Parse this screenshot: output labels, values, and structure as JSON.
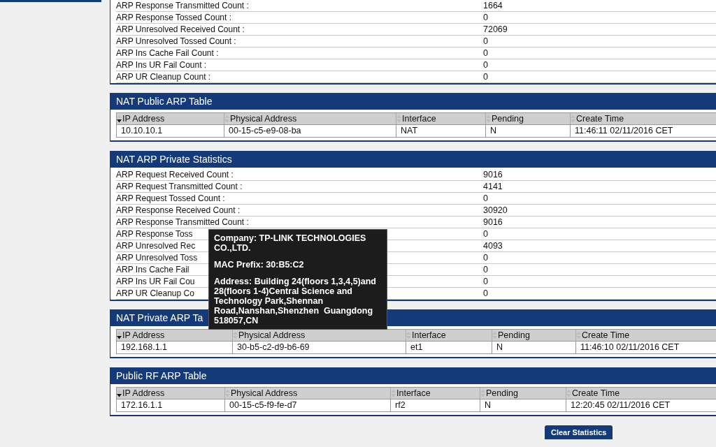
{
  "stats_top": {
    "rows": [
      {
        "label": "ARP Response Transmitted Count :",
        "value": "1664"
      },
      {
        "label": "ARP Response Tossed Count :",
        "value": "0"
      },
      {
        "label": "ARP Unresolved Received Count :",
        "value": "72069"
      },
      {
        "label": "ARP Unresolved Tossed Count :",
        "value": "0"
      },
      {
        "label": "ARP Ins Cache Fail Count :",
        "value": "0"
      },
      {
        "label": "ARP Ins UR Fail Count :",
        "value": "0"
      },
      {
        "label": "ARP UR Cleanup Count :",
        "value": "0"
      }
    ]
  },
  "nat_public_arp_table": {
    "title": "NAT Public ARP Table",
    "columns": [
      {
        "label": "IP Address",
        "sorted": true
      },
      {
        "label": "Physical Address",
        "sorted": false
      },
      {
        "label": "Interface",
        "sorted": false
      },
      {
        "label": "Pending",
        "sorted": false
      },
      {
        "label": "Create Time",
        "sorted": false
      }
    ],
    "rows": [
      [
        "10.10.10.1",
        "00-15-c5-e9-08-ba",
        "NAT",
        "N",
        "11:46:11 02/11/2016 CET"
      ]
    ]
  },
  "nat_arp_private_statistics": {
    "title": "NAT ARP Private Statistics",
    "rows": [
      {
        "label": "ARP Request Received Count :",
        "value": "9016"
      },
      {
        "label": "ARP Request Transmitted Count :",
        "value": "4141"
      },
      {
        "label": "ARP Request Tossed Count :",
        "value": "0"
      },
      {
        "label": "ARP Response Received Count :",
        "value": "30920"
      },
      {
        "label": "ARP Response Transmitted Count :",
        "value": "9016"
      },
      {
        "label": "ARP Response Toss",
        "value": "0"
      },
      {
        "label": "ARP Unresolved Rec",
        "value": "4093"
      },
      {
        "label": "ARP Unresolved Toss",
        "value": "0"
      },
      {
        "label": "ARP Ins Cache Fail",
        "value": "0"
      },
      {
        "label": "ARP Ins UR Fail Cou",
        "value": "0"
      },
      {
        "label": "ARP UR Cleanup Co",
        "value": "0"
      }
    ]
  },
  "nat_private_arp_table": {
    "title": "NAT Private ARP Ta",
    "columns": [
      {
        "label": "IP Address",
        "sorted": true
      },
      {
        "label": "Physical Address",
        "sorted": false
      },
      {
        "label": "Interface",
        "sorted": false
      },
      {
        "label": "Pending",
        "sorted": false
      },
      {
        "label": "Create Time",
        "sorted": false
      }
    ],
    "rows": [
      [
        "192.168.1.1",
        "30-b5-c2-d9-b6-69",
        "et1",
        "N",
        "11:46:10 02/11/2016 CET"
      ]
    ]
  },
  "public_rf_arp_table": {
    "title": "Public RF ARP Table",
    "columns": [
      {
        "label": "IP Address",
        "sorted": true
      },
      {
        "label": "Physical Address",
        "sorted": false
      },
      {
        "label": "Interface",
        "sorted": false
      },
      {
        "label": "Pending",
        "sorted": false
      },
      {
        "label": "Create Time",
        "sorted": false
      }
    ],
    "rows": [
      [
        "172.16.1.1",
        "00-15-c5-f9-fe-d7",
        "rf2",
        "N",
        "12:20:45 02/11/2016 CET"
      ]
    ]
  },
  "tooltip": {
    "company": "Company: TP-LINK TECHNOLOGIES CO.,LTD.",
    "mac_prefix": "MAC Prefix: 30:B5:C2",
    "address": "Address: Building 24(floors 1,3,4,5)and 28(floors 1-4)Central Science and Technology Park,Shennan Road,Nanshan,Shenzhen  Guangdong 518057,CN"
  },
  "clear_button": "Clear Statistics"
}
